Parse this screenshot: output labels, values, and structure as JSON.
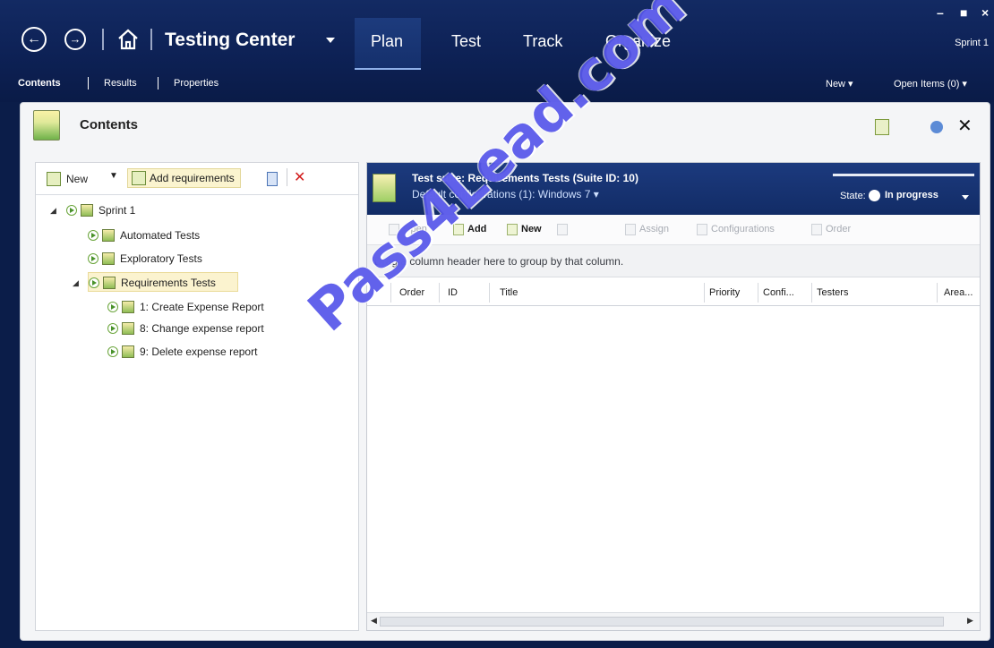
{
  "header": {
    "title": "Testing Center",
    "tabs": [
      {
        "label": "Plan"
      },
      {
        "label": "Test"
      },
      {
        "label": "Track"
      },
      {
        "label": "Organize"
      }
    ],
    "window_controls": {
      "minimize": "–",
      "maximize": "■",
      "close": "×"
    },
    "sprint": "Sprint 1"
  },
  "subnav": {
    "items": [
      "Contents",
      "Results",
      "Properties"
    ],
    "new": "New ▾",
    "open_items": "Open Items (0) ▾"
  },
  "panel": {
    "title": "Contents",
    "close": "✕"
  },
  "tree": {
    "toolbar": {
      "new": "New",
      "add_requirements": "Add requirements",
      "delete": "✕"
    },
    "items": [
      {
        "label": "Sprint 1"
      },
      {
        "label": "Automated Tests"
      },
      {
        "label": "Exploratory Tests"
      },
      {
        "label": "Requirements Tests"
      },
      {
        "label": "1: Create Expense Report"
      },
      {
        "label": "8: Change expense report"
      },
      {
        "label": "9: Delete expense report"
      }
    ]
  },
  "suite": {
    "title": "Test suite:  Requirements Tests (Suite ID: 10)",
    "config": "Default configurations (1):  Windows 7 ▾",
    "state_label": "State:",
    "state_value": "In progress"
  },
  "right_toolbar": {
    "open": "Open",
    "add": "Add",
    "new": "New",
    "assign": "Assign",
    "configurations": "Configurations",
    "order": "Order"
  },
  "grid": {
    "group_hint": "Drag a column header here to group by that column.",
    "columns": [
      "Order",
      "ID",
      "Title",
      "Priority",
      "Confi...",
      "Testers",
      "Area..."
    ]
  },
  "watermark": "Pass4Lead.com"
}
